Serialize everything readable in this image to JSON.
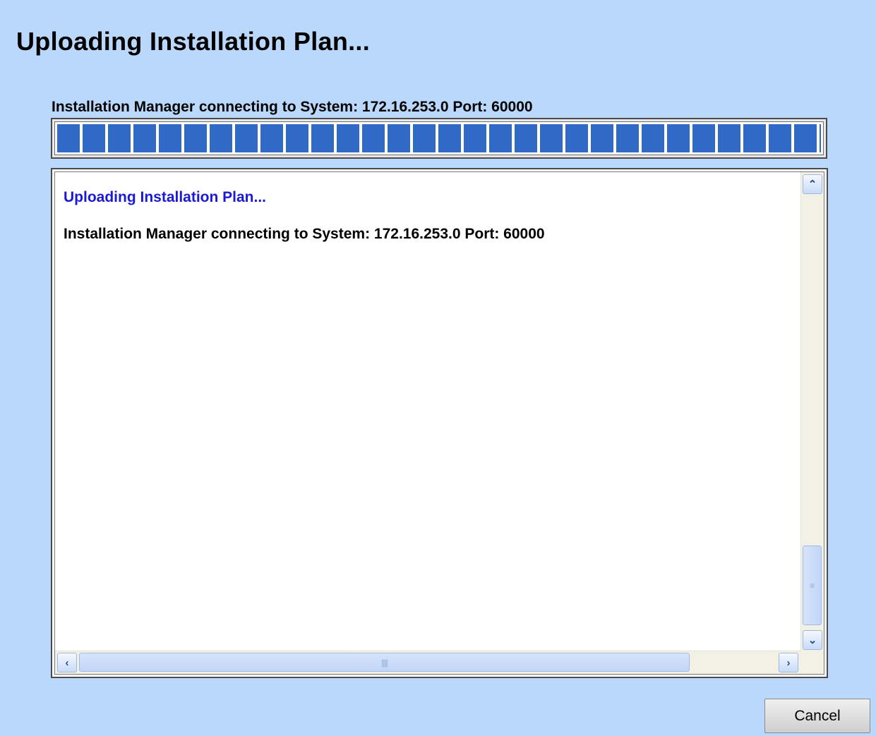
{
  "page": {
    "title": "Uploading Installation Plan..."
  },
  "status": {
    "message": "Installation Manager connecting to System: 172.16.253.0 Port: 60000",
    "progress_fraction": 1.0,
    "bar_color": "#3169c6"
  },
  "log": {
    "lines": [
      {
        "text": "Uploading Installation Plan...",
        "color": "#1a1ad6"
      },
      {
        "text": "Installation Manager connecting to System: 172.16.253.0 Port: 60000",
        "color": "#000000"
      }
    ]
  },
  "scrollbars": {
    "up_icon": "chevron-up-icon",
    "down_icon": "chevron-down-icon",
    "left_icon": "chevron-left-icon",
    "right_icon": "chevron-right-icon"
  },
  "buttons": {
    "cancel_label": "Cancel"
  }
}
